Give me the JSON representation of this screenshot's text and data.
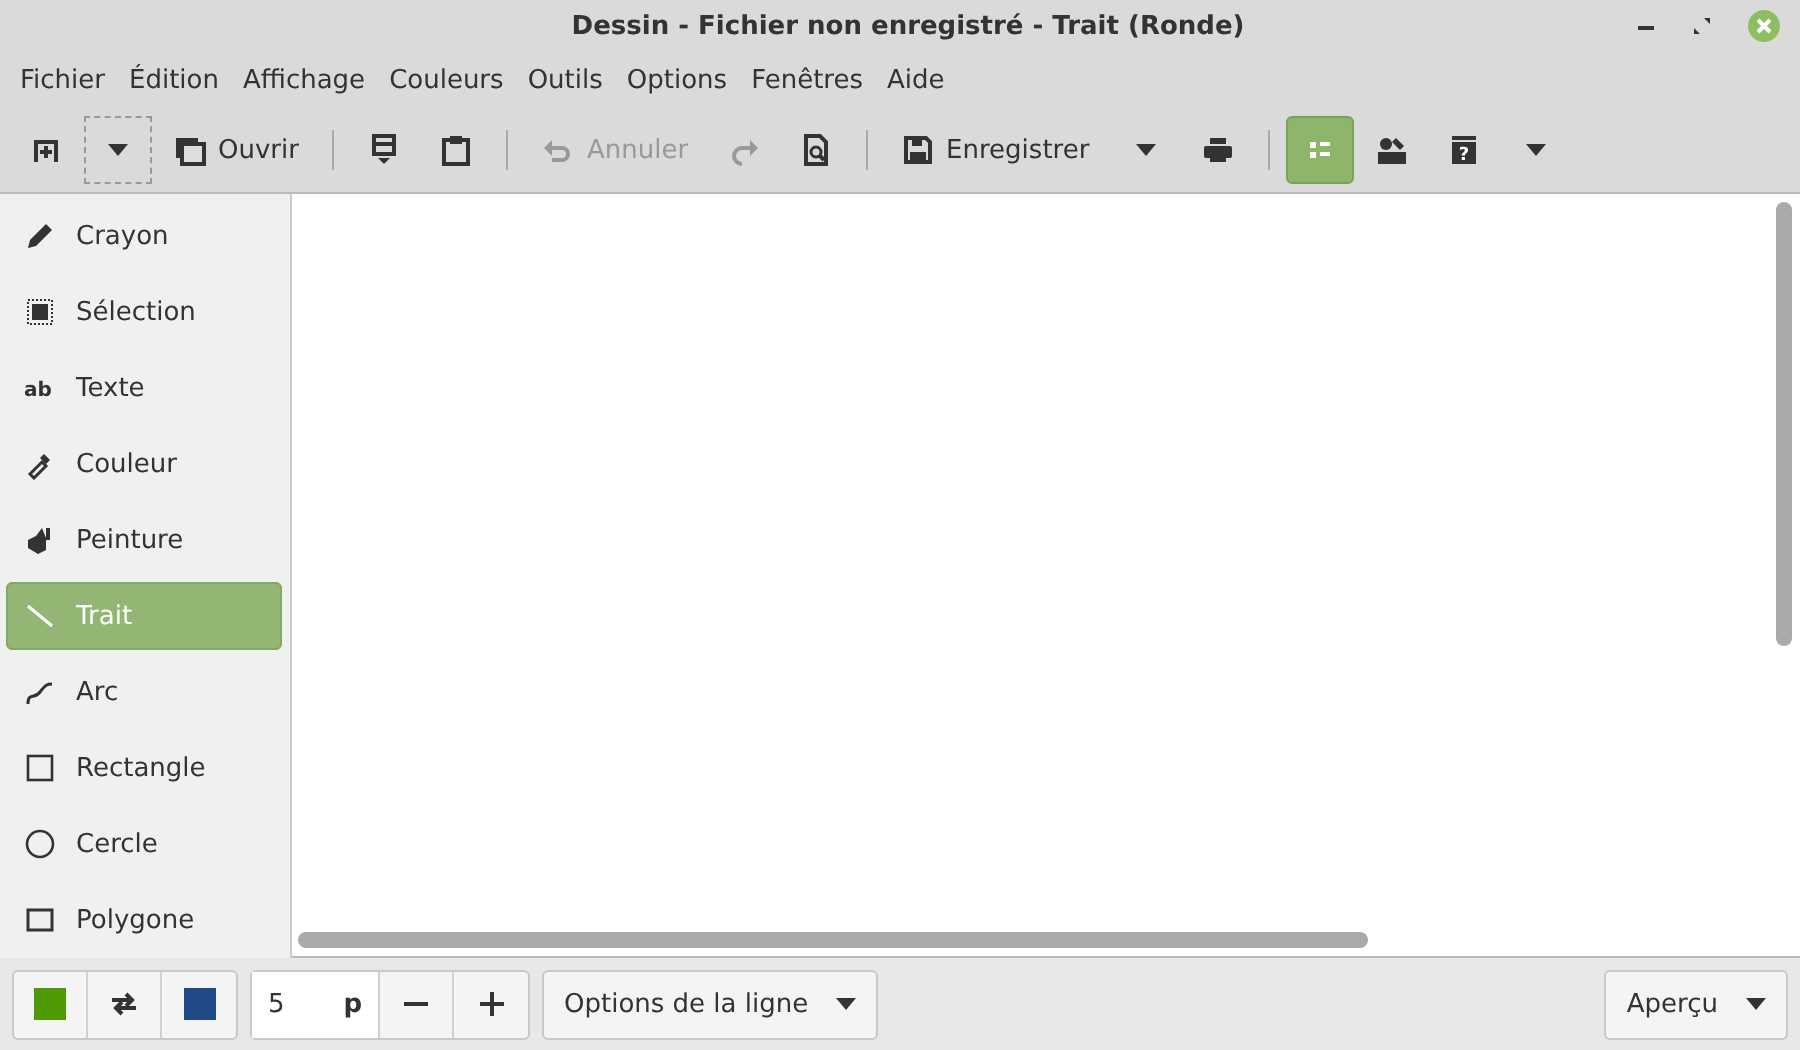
{
  "window": {
    "title": "Dessin - Fichier non enregistré - Trait (Ronde)"
  },
  "menu": [
    "Fichier",
    "Édition",
    "Affichage",
    "Couleurs",
    "Outils",
    "Options",
    "Fenêtres",
    "Aide"
  ],
  "toolbar": [
    {
      "kind": "button",
      "disabled": false,
      "selected": false
    },
    {
      "kind": "dropdown",
      "disabled": false,
      "selected": false
    },
    {
      "kind": "button",
      "label": "Ouvrir",
      "disabled": false,
      "selected": false
    },
    {
      "kind": "separator"
    },
    {
      "kind": "button",
      "disabled": false,
      "selected": false
    },
    {
      "kind": "button",
      "disabled": false,
      "selected": false
    },
    {
      "kind": "separator"
    },
    {
      "kind": "button",
      "label": "Annuler",
      "disabled": true,
      "selected": false
    },
    {
      "kind": "button",
      "disabled": true,
      "selected": false
    },
    {
      "kind": "button",
      "disabled": false,
      "selected": false
    },
    {
      "kind": "separator"
    },
    {
      "kind": "button",
      "label": "Enregistrer",
      "disabled": false,
      "selected": false
    },
    {
      "kind": "caret",
      "disabled": false,
      "selected": false
    },
    {
      "kind": "button",
      "disabled": false,
      "selected": false
    },
    {
      "kind": "separator"
    },
    {
      "kind": "button",
      "disabled": false,
      "selected": true
    },
    {
      "kind": "button",
      "disabled": false,
      "selected": false
    },
    {
      "kind": "button",
      "icon_text": "?",
      "disabled": false,
      "selected": false
    },
    {
      "kind": "caret",
      "disabled": false,
      "selected": false
    }
  ],
  "tools": [
    {
      "label": "Crayon",
      "selected": false
    },
    {
      "label": "Sélection",
      "selected": false
    },
    {
      "label": "Texte",
      "icon_text": "ab",
      "selected": false
    },
    {
      "label": "Couleur",
      "selected": false
    },
    {
      "label": "Peinture",
      "selected": false
    },
    {
      "label": "Trait",
      "selected": true
    },
    {
      "label": "Arc",
      "selected": false
    },
    {
      "label": "Rectangle",
      "selected": false
    },
    {
      "label": "Cercle",
      "selected": false
    },
    {
      "label": "Polygone",
      "selected": false
    }
  ],
  "bottom_bar": {
    "colors": [
      {
        "color": "#4e9a06"
      },
      {
        "color": "#204a87"
      }
    ],
    "size": "5",
    "unit": "p",
    "options_label": "Options de la ligne",
    "preview_label": "Aperçu"
  }
}
